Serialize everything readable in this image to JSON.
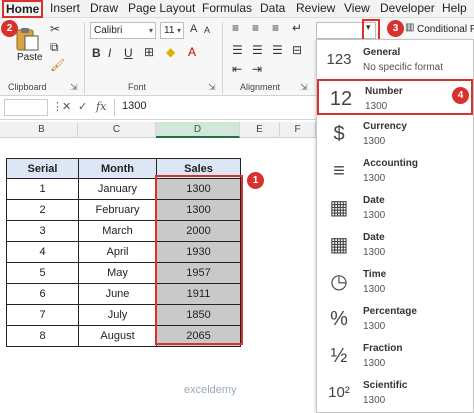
{
  "menu": {
    "items": [
      "Home",
      "Insert",
      "Draw",
      "Page Layout",
      "Formulas",
      "Data",
      "Review",
      "View",
      "Developer",
      "Help"
    ]
  },
  "ribbon": {
    "paste_label": "Paste",
    "clipboard_label": "Clipboard",
    "font_label": "Font",
    "alignment_label": "Alignment",
    "font_name": "Calibri",
    "font_size": "11",
    "bold": "B",
    "italic": "I",
    "underline": "U",
    "font_grow": "A",
    "font_shrink": "A",
    "number_format_value": "",
    "conditional_label": "Conditional Fo"
  },
  "formula_bar": {
    "fx": "fx",
    "value": "1300"
  },
  "columns": [
    "B",
    "C",
    "D",
    "E",
    "F"
  ],
  "table": {
    "headers": [
      "Serial",
      "Month",
      "Sales"
    ],
    "rows": [
      [
        "1",
        "January",
        "1300"
      ],
      [
        "2",
        "February",
        "1300"
      ],
      [
        "3",
        "March",
        "2000"
      ],
      [
        "4",
        "April",
        "1930"
      ],
      [
        "5",
        "May",
        "1957"
      ],
      [
        "6",
        "June",
        "1911"
      ],
      [
        "7",
        "July",
        "1850"
      ],
      [
        "8",
        "August",
        "2065"
      ]
    ]
  },
  "formats": [
    {
      "name": "General",
      "example": "No specific format",
      "icon": "123"
    },
    {
      "name": "Number",
      "example": "1300",
      "icon": "12"
    },
    {
      "name": "Currency",
      "example": "1300",
      "icon": "$"
    },
    {
      "name": "Accounting",
      "example": "1300",
      "icon": "≡"
    },
    {
      "name": "Date",
      "example": "1300",
      "icon": "▦"
    },
    {
      "name": "Date",
      "example": "1300",
      "icon": "▦"
    },
    {
      "name": "Time",
      "example": "1300",
      "icon": "◷"
    },
    {
      "name": "Percentage",
      "example": "1300",
      "icon": "%"
    },
    {
      "name": "Fraction",
      "example": "1300",
      "icon": "½"
    },
    {
      "name": "Scientific",
      "example": "1300",
      "icon": "10²"
    }
  ],
  "badges": [
    "1",
    "2",
    "3",
    "4"
  ],
  "watermark": "exceldemy",
  "colors": {
    "accent_red": "#d9322e",
    "header_fill": "#dce6f4",
    "selection_fill": "#c9c9c9",
    "excel_green": "#217346"
  }
}
